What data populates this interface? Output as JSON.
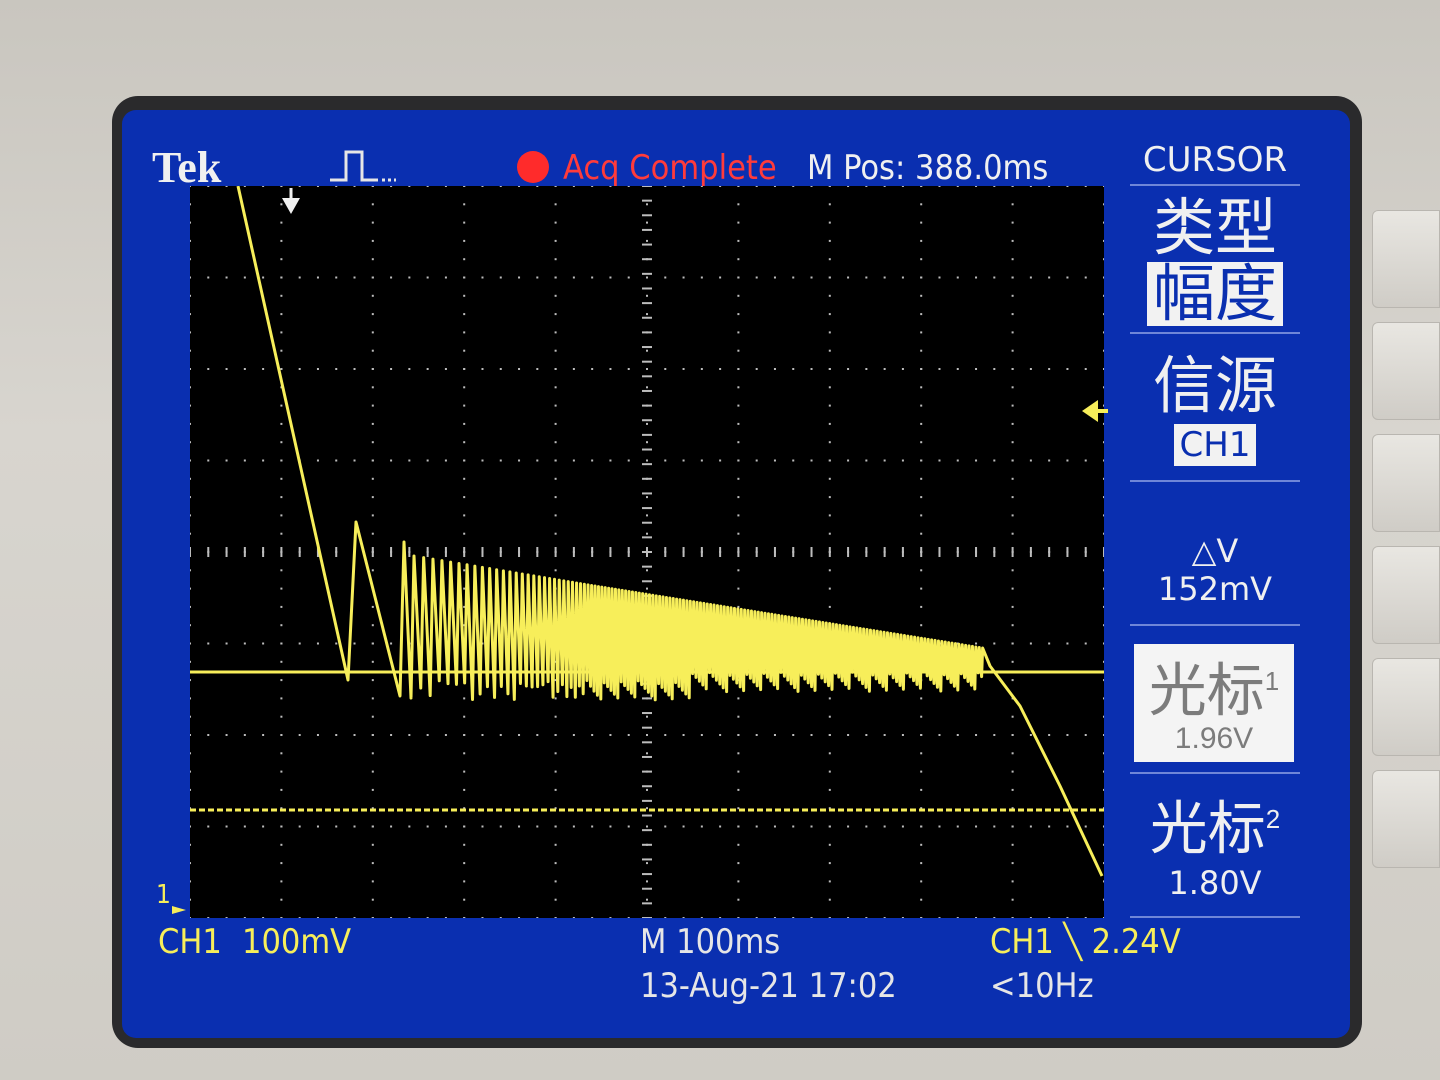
{
  "header": {
    "brand": "Tek",
    "status": "Acq Complete",
    "m_pos": "M Pos: 388.0ms"
  },
  "menu": {
    "title": "CURSOR",
    "type_label": "类型",
    "type_value": "幅度",
    "source_label": "信源",
    "source_value": "CH1",
    "delta_v": "△V 152mV",
    "cursor1_label": "光标",
    "cursor1_index": "1",
    "cursor1_value": "1.96V",
    "cursor2_label": "光标",
    "cursor2_index": "2",
    "cursor2_value": "1.80V"
  },
  "footer": {
    "ch1_label": "CH1",
    "ch1_scale": "100mV",
    "timebase": "M 100ms",
    "datetime": "13-Aug-21 17:02",
    "trigger": "CH1 ╲ 2.24V",
    "freq": "<10Hz",
    "ch1_marker": "1"
  },
  "colors": {
    "screen_bg": "#0a2fb0",
    "trace": "#f7ee5a",
    "status_red": "#ff2b2b"
  }
}
